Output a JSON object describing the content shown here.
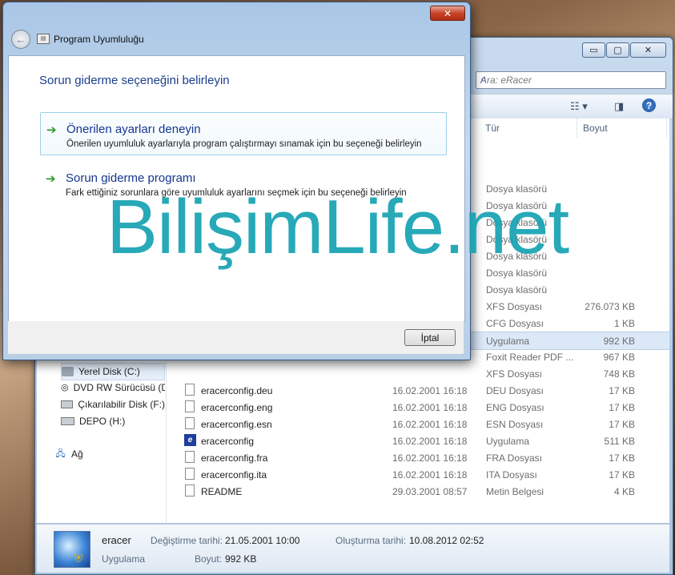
{
  "explorer": {
    "caption_buttons": [
      "▭",
      "▢",
      "✕"
    ],
    "search_placeholder": "Ara: eRacer",
    "columns": {
      "type": "Tür",
      "size": "Boyut"
    },
    "nav_items": [
      {
        "label": "Yerel Disk (C:)",
        "icon": "hard-disk-icon",
        "selected": true
      },
      {
        "label": "DVD RW Sürücüsü (D:)",
        "icon": "dvd-drive-icon",
        "selected": false
      },
      {
        "label": "Çıkarılabilir Disk (F:)",
        "icon": "removable-disk-icon",
        "selected": false
      },
      {
        "label": "DEPO (H:)",
        "icon": "hard-disk-icon",
        "selected": false
      },
      {
        "label": "Ağ",
        "icon": "network-icon",
        "selected": false
      }
    ],
    "rows": [
      {
        "name": "",
        "date": "",
        "type": "Dosya klasörü",
        "size": "",
        "icon": "folder-icon"
      },
      {
        "name": "",
        "date": "",
        "type": "Dosya klasörü",
        "size": "",
        "icon": "folder-icon"
      },
      {
        "name": "",
        "date": "",
        "type": "Dosya klasörü",
        "size": "",
        "icon": "folder-icon"
      },
      {
        "name": "",
        "date": "",
        "type": "Dosya klasörü",
        "size": "",
        "icon": "folder-icon"
      },
      {
        "name": "",
        "date": "",
        "type": "Dosya klasörü",
        "size": "",
        "icon": "folder-icon"
      },
      {
        "name": "",
        "date": "",
        "type": "Dosya klasörü",
        "size": "",
        "icon": "folder-icon"
      },
      {
        "name": "",
        "date": "",
        "type": "Dosya klasörü",
        "size": "",
        "icon": "folder-icon"
      },
      {
        "name": "",
        "date": "",
        "type": "XFS Dosyası",
        "size": "276.073 KB",
        "icon": "file-icon"
      },
      {
        "name": "",
        "date": "",
        "type": "CFG Dosyası",
        "size": "1 KB",
        "icon": "file-icon"
      },
      {
        "name": "",
        "date": "",
        "type": "Uygulama",
        "size": "992 KB",
        "icon": "app-icon",
        "selected": true
      },
      {
        "name": "",
        "date": "",
        "type": "Foxit Reader PDF ...",
        "size": "967 KB",
        "icon": "pdf-icon"
      },
      {
        "name": "",
        "date": "",
        "type": "XFS Dosyası",
        "size": "748 KB",
        "icon": "file-icon"
      },
      {
        "name": "eracerconfig.deu",
        "date": "16.02.2001 16:18",
        "type": "DEU Dosyası",
        "size": "17 KB",
        "icon": "file-icon"
      },
      {
        "name": "eracerconfig.eng",
        "date": "16.02.2001 16:18",
        "type": "ENG Dosyası",
        "size": "17 KB",
        "icon": "file-icon"
      },
      {
        "name": "eracerconfig.esn",
        "date": "16.02.2001 16:18",
        "type": "ESN Dosyası",
        "size": "17 KB",
        "icon": "file-icon"
      },
      {
        "name": "eracerconfig",
        "date": "16.02.2001 16:18",
        "type": "Uygulama",
        "size": "511 KB",
        "icon": "app-icon"
      },
      {
        "name": "eracerconfig.fra",
        "date": "16.02.2001 16:18",
        "type": "FRA Dosyası",
        "size": "17 KB",
        "icon": "file-icon"
      },
      {
        "name": "eracerconfig.ita",
        "date": "16.02.2001 16:18",
        "type": "ITA Dosyası",
        "size": "17 KB",
        "icon": "file-icon"
      },
      {
        "name": "README",
        "date": "29.03.2001 08:57",
        "type": "Metin Belgesi",
        "size": "4 KB",
        "icon": "file-icon"
      }
    ],
    "details": {
      "name": "eracer",
      "kind": "Uygulama",
      "modified_label": "Değiştirme tarihi:",
      "modified_value": "21.05.2001 10:00",
      "created_label": "Oluşturma tarihi:",
      "created_value": "10.08.2012 02:52",
      "size_label": "Boyut:",
      "size_value": "992 KB"
    }
  },
  "dialog": {
    "close_label": "✕",
    "back_label": "←",
    "title": "Program Uyumluluğu",
    "heading": "Sorun giderme seçeneğini belirleyin",
    "options": [
      {
        "title": "Önerilen ayarları deneyin",
        "description": "Önerilen uyumluluk ayarlarıyla program çalıştırmayı sınamak için bu seçeneği belirleyin",
        "arrow": "➔"
      },
      {
        "title": "Sorun giderme programı",
        "description": "Fark ettiğiniz sorunlara göre uyumluluk ayarlarını seçmek için bu seçeneği belirleyin",
        "arrow": "➔"
      }
    ],
    "cancel_label": "İptal"
  },
  "watermark": "BilişimLife.net",
  "colors": {
    "accent": "#16368f",
    "watermark": "#17a3b3",
    "selection": "#dbe8f8"
  }
}
